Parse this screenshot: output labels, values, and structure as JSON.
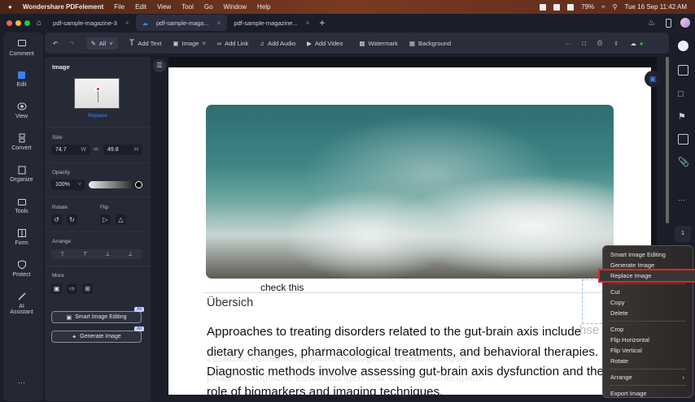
{
  "menubar": {
    "apple": "",
    "app": "Wondershare PDFelement",
    "items": [
      "File",
      "Edit",
      "View",
      "Tool",
      "Go",
      "Window",
      "Help"
    ],
    "battery": "79%",
    "datetime": "Tue 16 Sep  11:42 AM"
  },
  "tabs": [
    {
      "label": "pdf-sample-magazine-3"
    },
    {
      "label": "pdf-sample-maga..."
    },
    {
      "label": "pdf-sample-magazine..."
    }
  ],
  "toolbar": {
    "all": "All",
    "add_text": "Add Text",
    "image": "Image",
    "add_link": "Add Link",
    "add_audio": "Add Audio",
    "add_video": "Add Video",
    "watermark": "Watermark",
    "background": "Background",
    "more": "···"
  },
  "nav": [
    {
      "label": "Comment"
    },
    {
      "label": "Edit"
    },
    {
      "label": "View"
    },
    {
      "label": "Convert"
    },
    {
      "label": "Organize"
    },
    {
      "label": "Tools"
    },
    {
      "label": "Form"
    },
    {
      "label": "Protect"
    },
    {
      "label": "AI Assistant"
    },
    {
      "label": "···"
    }
  ],
  "props": {
    "title": "Image",
    "replace": "Replace",
    "size_label": "Size",
    "width": "74.7",
    "w": "W",
    "height": "49.8",
    "h": "H",
    "opacity_label": "Opacity",
    "opacity": "100%",
    "opacity_value": 100,
    "rotate_label": "Rotate",
    "flip_label": "Flip",
    "arrange_label": "Arrange",
    "more_label": "More",
    "smart_btn": "Smart Image Editing",
    "gen_btn": "Generate Image",
    "ai_badge": "AI"
  },
  "doc": {
    "note": "check this",
    "heading": "Übersich",
    "lines": [
      "Approaches to treating disorders related to the gut-brain axis include",
      "dietary changes, pharmacological treatments, and behavioral therapies.",
      "Diagnostic methods involve assessing gut-brain axis dysfunction and the",
      "role of biomarkers and imaging techniques."
    ],
    "underlay": [
      "hse",
      "zusätzlich ernährung, pharmakologische behandlungen",
      "pharmakologische Behandlungen und Verhaltenstherapien."
    ]
  },
  "context_menu": {
    "items": [
      "Smart Image Editing",
      "Generate Image",
      "Replace Image",
      "Cut",
      "Copy",
      "Delete",
      "Crop",
      "Flip Horizontal",
      "Flip Vertical",
      "Rotate",
      "Arrange",
      "Export Image"
    ],
    "highlighted": "Replace Image",
    "highlight_color": "#e0252b"
  },
  "right_sidebar": {
    "page_number": "1"
  },
  "colors": {
    "accent": "#3a82f7",
    "panel": "#262a37"
  }
}
